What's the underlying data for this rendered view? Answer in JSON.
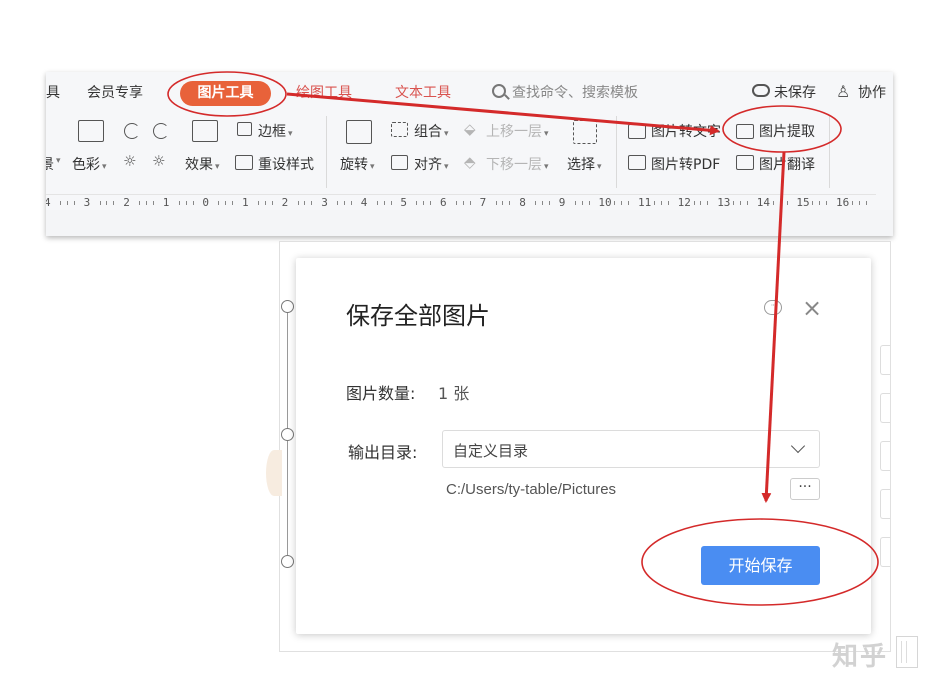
{
  "tabs": {
    "partial_left": "具",
    "member": "会员专享",
    "picture_tools": "图片工具",
    "drawing_tools": "绘图工具",
    "text_tools": "文本工具",
    "search_placeholder": "查找命令、搜索模板",
    "unsaved": "未保存",
    "collaborate": "协作"
  },
  "toolbar": {
    "partial_left": "景",
    "color": "色彩",
    "effects": "效果",
    "border": "边框",
    "reset_style": "重设样式",
    "rotate": "旋转",
    "group": "组合",
    "align": "对齐",
    "bring_forward": "上移一层",
    "send_backward": "下移一层",
    "select": "选择",
    "image_to_text": "图片转文字",
    "image_extract": "图片提取",
    "image_to_pdf": "图片转PDF",
    "image_translate": "图片翻译"
  },
  "ruler": {
    "labels": [
      "4",
      "3",
      "2",
      "1",
      "0",
      "1",
      "2",
      "3",
      "4",
      "5",
      "6",
      "7",
      "8",
      "9",
      "10",
      "11",
      "12",
      "13",
      "14",
      "15",
      "16"
    ]
  },
  "dialog": {
    "title": "保存全部图片",
    "count_label": "图片数量:",
    "count_value": "1 张",
    "output_label": "输出目录:",
    "output_value": "自定义目录",
    "path": "C:/Users/ty-table/Pictures",
    "browse": "···",
    "start_button": "开始保存",
    "chat_glyph": "···"
  },
  "watermark": {
    "text": "知乎"
  },
  "colors": {
    "accent_tab": "#e8623a",
    "primary_button": "#4a8df2",
    "annotation": "#d42a2a"
  }
}
